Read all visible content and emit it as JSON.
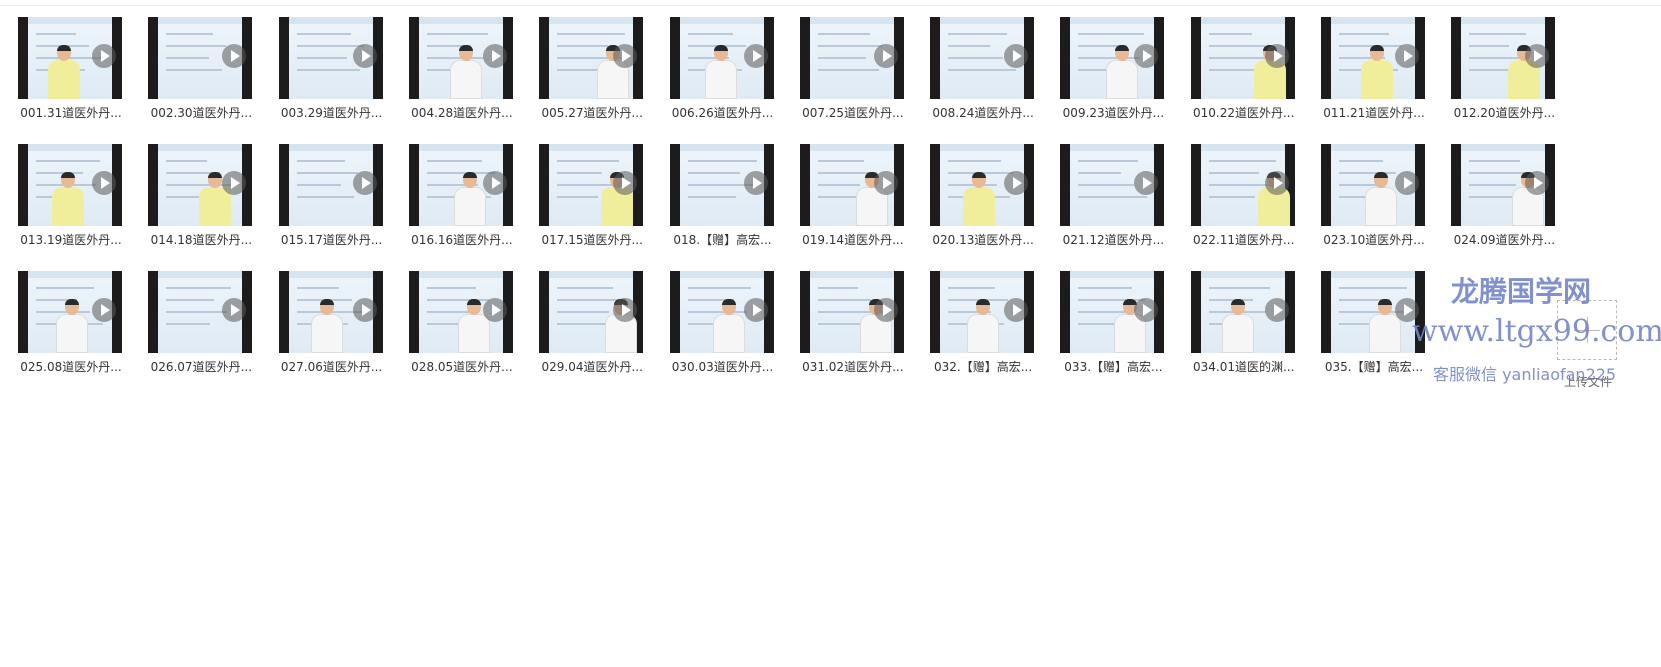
{
  "files": [
    {
      "name": "001.31道医外丹...",
      "person": "yellow"
    },
    {
      "name": "002.30道医外丹...",
      "person": "none"
    },
    {
      "name": "003.29道医外丹...",
      "person": "none"
    },
    {
      "name": "004.28道医外丹...",
      "person": "white"
    },
    {
      "name": "005.27道医外丹...",
      "person": "white"
    },
    {
      "name": "006.26道医外丹...",
      "person": "white"
    },
    {
      "name": "007.25道医外丹...",
      "person": "none"
    },
    {
      "name": "008.24道医外丹...",
      "person": "none"
    },
    {
      "name": "009.23道医外丹...",
      "person": "white"
    },
    {
      "name": "010.22道医外丹...",
      "person": "yellow"
    },
    {
      "name": "011.21道医外丹...",
      "person": "yellow"
    },
    {
      "name": "012.20道医外丹...",
      "person": "yellow"
    },
    {
      "name": "013.19道医外丹...",
      "person": "yellow"
    },
    {
      "name": "014.18道医外丹...",
      "person": "yellow"
    },
    {
      "name": "015.17道医外丹...",
      "person": "none"
    },
    {
      "name": "016.16道医外丹...",
      "person": "white"
    },
    {
      "name": "017.15道医外丹...",
      "person": "yellow"
    },
    {
      "name": "018.【赠】高宏...",
      "person": "none"
    },
    {
      "name": "019.14道医外丹...",
      "person": "white"
    },
    {
      "name": "020.13道医外丹...",
      "person": "yellow"
    },
    {
      "name": "021.12道医外丹...",
      "person": "none"
    },
    {
      "name": "022.11道医外丹...",
      "person": "yellow"
    },
    {
      "name": "023.10道医外丹...",
      "person": "white"
    },
    {
      "name": "024.09道医外丹...",
      "person": "white"
    },
    {
      "name": "025.08道医外丹...",
      "person": "white"
    },
    {
      "name": "026.07道医外丹...",
      "person": "none"
    },
    {
      "name": "027.06道医外丹...",
      "person": "white"
    },
    {
      "name": "028.05道医外丹...",
      "person": "white"
    },
    {
      "name": "029.04道医外丹...",
      "person": "white"
    },
    {
      "name": "030.03道医外丹...",
      "person": "white"
    },
    {
      "name": "031.02道医外丹...",
      "person": "white"
    },
    {
      "name": "032.【赠】高宏...",
      "person": "white"
    },
    {
      "name": "033.【赠】高宏...",
      "person": "white"
    },
    {
      "name": "034.01道医的渊...",
      "person": "white"
    },
    {
      "name": "035.【赠】高宏...",
      "person": "white"
    }
  ],
  "upload": {
    "label": "上传文件"
  },
  "watermark": {
    "line1": "龙腾国学网",
    "line2": "www.ltgx99.com",
    "line3": "客服微信 yanliaofan225"
  },
  "colors": {
    "tile_bg": "#1c1c1c",
    "screen": "#eef5fb",
    "robe_yellow": "#f1ee9b",
    "watermark": "#7486c8"
  }
}
